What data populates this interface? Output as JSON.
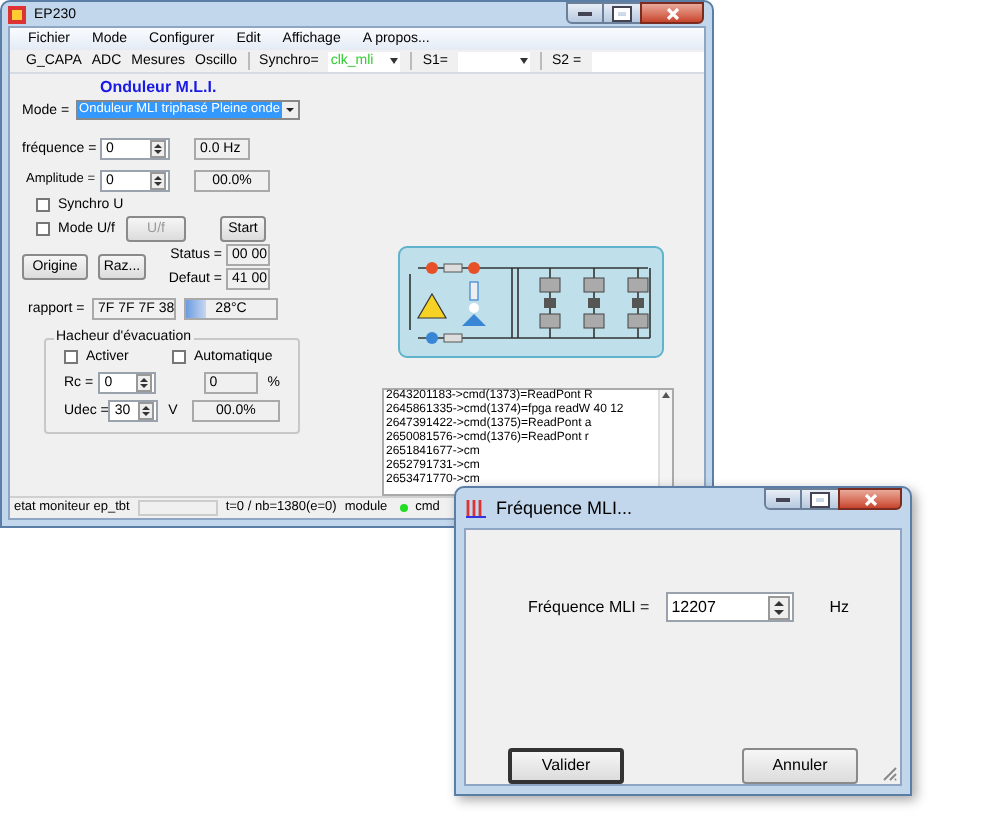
{
  "window": {
    "title": "EP230"
  },
  "menu": [
    "Fichier",
    "Mode",
    "Configurer",
    "Edit",
    "Affichage",
    "A propos..."
  ],
  "toolbar": {
    "buttons": [
      "G_CAPA",
      "ADC",
      "Mesures",
      "Oscillo"
    ],
    "synchro": {
      "label": "Synchro=",
      "value": "clk_mli"
    },
    "s1": {
      "label": "S1="
    },
    "s2": {
      "label": "S2 ="
    }
  },
  "heading": "Onduleur M.L.I.",
  "mode": {
    "label": "Mode =",
    "value": "Onduleur MLI triphasé Pleine onde"
  },
  "frequence": {
    "label": "fréquence =",
    "value": "0",
    "reading": "0.0 Hz"
  },
  "amplitude": {
    "label": "Amplitude =",
    "value": "0",
    "reading": "00.0%"
  },
  "synchro_u": {
    "label": "Synchro U",
    "checked": false
  },
  "mode_uf": {
    "label": "Mode U/f",
    "checked": false
  },
  "uf_button": {
    "label": "U/f",
    "disabled": true
  },
  "start_button": {
    "label": "Start",
    "disabled": false
  },
  "origine_button": "Origine",
  "raz_button": "Raz...",
  "status": {
    "label": "Status =",
    "value": "00 00"
  },
  "defaut": {
    "label": "Defaut =",
    "value": "41 00"
  },
  "rapport": {
    "label": "rapport =",
    "value": "7F 7F 7F 38"
  },
  "temperature": {
    "level": 0.22,
    "reading": "28°C"
  },
  "hacheur": {
    "title": "Hacheur d'évacuation",
    "activer": {
      "label": "Activer",
      "checked": false
    },
    "automatique": {
      "label": "Automatique",
      "checked": false
    },
    "rc": {
      "label": "Rc =",
      "value": "0",
      "reading": "0",
      "unit": "%"
    },
    "udec": {
      "label": "Udec =",
      "value": "30",
      "unit": "V",
      "reading": "00.0%"
    }
  },
  "log": [
    "2643201183->cmd(1373)=ReadPont R",
    "2645861335->cmd(1374)=fpga readW 40 12",
    "2647391422->cmd(1375)=ReadPont a",
    "2650081576->cmd(1376)=ReadPont r",
    "2651841677->cm",
    "2652791731->cm",
    "2653471770->cm"
  ],
  "status_bar": {
    "state": "etat moniteur ep_tbt",
    "counter": "t=0 / nb=1380(e=0)",
    "module": "module",
    "cmd": {
      "label": "cmd",
      "on": true
    }
  },
  "dialog": {
    "title": "Fréquence MLI...",
    "field": {
      "label": "Fréquence MLI =",
      "value": "12207",
      "unit": "Hz"
    },
    "buttons": [
      {
        "label": "Valider",
        "default": true
      },
      {
        "label": "Annuler",
        "default": false
      }
    ]
  }
}
